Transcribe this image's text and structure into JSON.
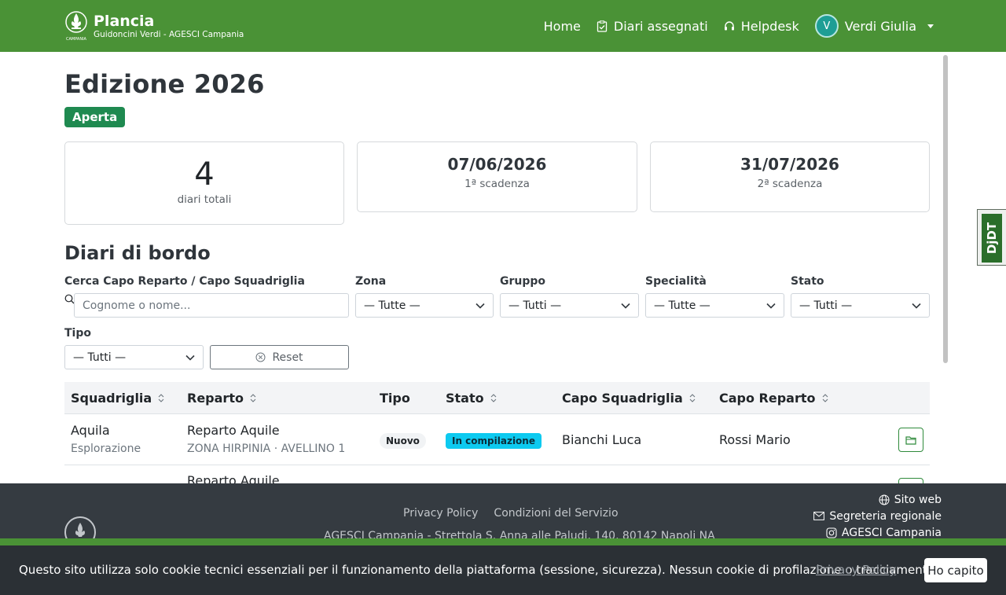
{
  "navbar": {
    "brand_title": "Plancia",
    "brand_subtitle": "Guidoncini Verdi - AGESCI Campania",
    "logo_caption": "CAMPANIA",
    "links": {
      "home": "Home",
      "diari": "Diari assegnati",
      "helpdesk": "Helpdesk"
    },
    "user": {
      "initial": "V",
      "name": "Verdi Giulia"
    }
  },
  "page": {
    "title": "Edizione 2026",
    "status_badge": "Aperta",
    "stats": {
      "total_value": "4",
      "total_label": "diari totali",
      "deadline1_value": "07/06/2026",
      "deadline1_label": "1ª scadenza",
      "deadline2_value": "31/07/2026",
      "deadline2_label": "2ª scadenza"
    }
  },
  "section": {
    "title": "Diari di bordo"
  },
  "filters": {
    "search_label": "Cerca Capo Reparto / Capo Squadriglia",
    "search_placeholder": "Cognome o nome...",
    "zona_label": "Zona",
    "zona_value": "— Tutte —",
    "gruppo_label": "Gruppo",
    "gruppo_value": "— Tutti —",
    "specialita_label": "Specialità",
    "specialita_value": "— Tutte —",
    "stato_label": "Stato",
    "stato_value": "— Tutti —",
    "tipo_label": "Tipo",
    "tipo_value": "— Tutti —",
    "reset_label": "Reset"
  },
  "table": {
    "headers": {
      "squadriglia": "Squadriglia",
      "reparto": "Reparto",
      "tipo": "Tipo",
      "stato": "Stato",
      "capo_squadriglia": "Capo Squadriglia",
      "capo_reparto": "Capo Reparto"
    },
    "rows": [
      {
        "squadriglia": "Aquila",
        "specialita": "Esplorazione",
        "reparto": "Reparto Aquile",
        "reparto_sub": "ZONA HIRPINIA · AVELLINO 1",
        "tipo": "Nuovo",
        "stato": "In compilazione",
        "capo_squadriglia": "Bianchi Luca",
        "capo_reparto": "Rossi Mario"
      },
      {
        "reparto": "Reparto Aquile"
      }
    ]
  },
  "footer": {
    "privacy": "Privacy Policy",
    "terms": "Condizioni del Servizio",
    "address": "AGESCI Campania - Strettola S. Anna alle Paludi, 140, 80142 Napoli NA",
    "sito_web": "Sito web",
    "segreteria": "Segreteria regionale",
    "instagram": "AGESCI Campania"
  },
  "cookie": {
    "text": "Questo sito utilizza solo cookie tecnici essenziali per il funzionamento della piattaforma (sessione, sicurezza). Nessun cookie di profilazione o tracciamento.",
    "link": "Privacy Policy",
    "button": "Ho capito"
  },
  "debug_toolbar": {
    "label": "DjDT"
  },
  "colors": {
    "brand_green": "#4a9236",
    "badge_open": "#1f8a50",
    "stato_info": "#0dcaf0",
    "footer_bg": "#353b41",
    "cookie_bg": "#2b3035"
  }
}
